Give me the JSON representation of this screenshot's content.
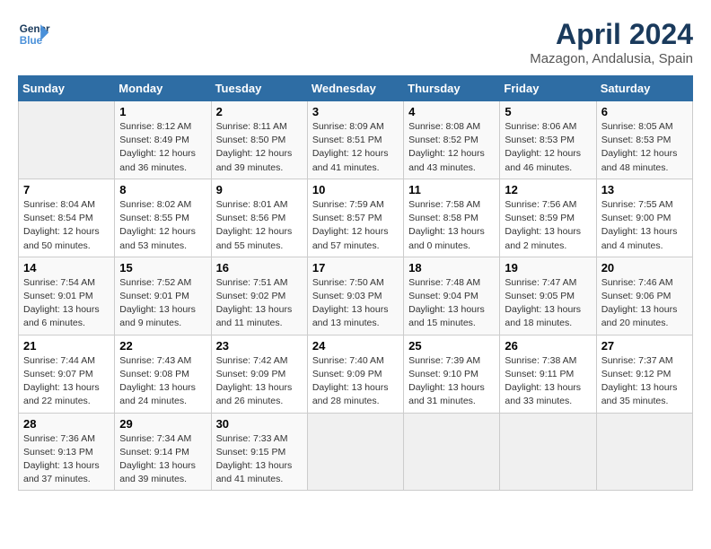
{
  "header": {
    "logo_line1": "General",
    "logo_line2": "Blue",
    "title": "April 2024",
    "subtitle": "Mazagon, Andalusia, Spain"
  },
  "columns": [
    "Sunday",
    "Monday",
    "Tuesday",
    "Wednesday",
    "Thursday",
    "Friday",
    "Saturday"
  ],
  "weeks": [
    [
      {
        "day": "",
        "info": ""
      },
      {
        "day": "1",
        "info": "Sunrise: 8:12 AM\nSunset: 8:49 PM\nDaylight: 12 hours\nand 36 minutes."
      },
      {
        "day": "2",
        "info": "Sunrise: 8:11 AM\nSunset: 8:50 PM\nDaylight: 12 hours\nand 39 minutes."
      },
      {
        "day": "3",
        "info": "Sunrise: 8:09 AM\nSunset: 8:51 PM\nDaylight: 12 hours\nand 41 minutes."
      },
      {
        "day": "4",
        "info": "Sunrise: 8:08 AM\nSunset: 8:52 PM\nDaylight: 12 hours\nand 43 minutes."
      },
      {
        "day": "5",
        "info": "Sunrise: 8:06 AM\nSunset: 8:53 PM\nDaylight: 12 hours\nand 46 minutes."
      },
      {
        "day": "6",
        "info": "Sunrise: 8:05 AM\nSunset: 8:53 PM\nDaylight: 12 hours\nand 48 minutes."
      }
    ],
    [
      {
        "day": "7",
        "info": "Sunrise: 8:04 AM\nSunset: 8:54 PM\nDaylight: 12 hours\nand 50 minutes."
      },
      {
        "day": "8",
        "info": "Sunrise: 8:02 AM\nSunset: 8:55 PM\nDaylight: 12 hours\nand 53 minutes."
      },
      {
        "day": "9",
        "info": "Sunrise: 8:01 AM\nSunset: 8:56 PM\nDaylight: 12 hours\nand 55 minutes."
      },
      {
        "day": "10",
        "info": "Sunrise: 7:59 AM\nSunset: 8:57 PM\nDaylight: 12 hours\nand 57 minutes."
      },
      {
        "day": "11",
        "info": "Sunrise: 7:58 AM\nSunset: 8:58 PM\nDaylight: 13 hours\nand 0 minutes."
      },
      {
        "day": "12",
        "info": "Sunrise: 7:56 AM\nSunset: 8:59 PM\nDaylight: 13 hours\nand 2 minutes."
      },
      {
        "day": "13",
        "info": "Sunrise: 7:55 AM\nSunset: 9:00 PM\nDaylight: 13 hours\nand 4 minutes."
      }
    ],
    [
      {
        "day": "14",
        "info": "Sunrise: 7:54 AM\nSunset: 9:01 PM\nDaylight: 13 hours\nand 6 minutes."
      },
      {
        "day": "15",
        "info": "Sunrise: 7:52 AM\nSunset: 9:01 PM\nDaylight: 13 hours\nand 9 minutes."
      },
      {
        "day": "16",
        "info": "Sunrise: 7:51 AM\nSunset: 9:02 PM\nDaylight: 13 hours\nand 11 minutes."
      },
      {
        "day": "17",
        "info": "Sunrise: 7:50 AM\nSunset: 9:03 PM\nDaylight: 13 hours\nand 13 minutes."
      },
      {
        "day": "18",
        "info": "Sunrise: 7:48 AM\nSunset: 9:04 PM\nDaylight: 13 hours\nand 15 minutes."
      },
      {
        "day": "19",
        "info": "Sunrise: 7:47 AM\nSunset: 9:05 PM\nDaylight: 13 hours\nand 18 minutes."
      },
      {
        "day": "20",
        "info": "Sunrise: 7:46 AM\nSunset: 9:06 PM\nDaylight: 13 hours\nand 20 minutes."
      }
    ],
    [
      {
        "day": "21",
        "info": "Sunrise: 7:44 AM\nSunset: 9:07 PM\nDaylight: 13 hours\nand 22 minutes."
      },
      {
        "day": "22",
        "info": "Sunrise: 7:43 AM\nSunset: 9:08 PM\nDaylight: 13 hours\nand 24 minutes."
      },
      {
        "day": "23",
        "info": "Sunrise: 7:42 AM\nSunset: 9:09 PM\nDaylight: 13 hours\nand 26 minutes."
      },
      {
        "day": "24",
        "info": "Sunrise: 7:40 AM\nSunset: 9:09 PM\nDaylight: 13 hours\nand 28 minutes."
      },
      {
        "day": "25",
        "info": "Sunrise: 7:39 AM\nSunset: 9:10 PM\nDaylight: 13 hours\nand 31 minutes."
      },
      {
        "day": "26",
        "info": "Sunrise: 7:38 AM\nSunset: 9:11 PM\nDaylight: 13 hours\nand 33 minutes."
      },
      {
        "day": "27",
        "info": "Sunrise: 7:37 AM\nSunset: 9:12 PM\nDaylight: 13 hours\nand 35 minutes."
      }
    ],
    [
      {
        "day": "28",
        "info": "Sunrise: 7:36 AM\nSunset: 9:13 PM\nDaylight: 13 hours\nand 37 minutes."
      },
      {
        "day": "29",
        "info": "Sunrise: 7:34 AM\nSunset: 9:14 PM\nDaylight: 13 hours\nand 39 minutes."
      },
      {
        "day": "30",
        "info": "Sunrise: 7:33 AM\nSunset: 9:15 PM\nDaylight: 13 hours\nand 41 minutes."
      },
      {
        "day": "",
        "info": ""
      },
      {
        "day": "",
        "info": ""
      },
      {
        "day": "",
        "info": ""
      },
      {
        "day": "",
        "info": ""
      }
    ]
  ]
}
